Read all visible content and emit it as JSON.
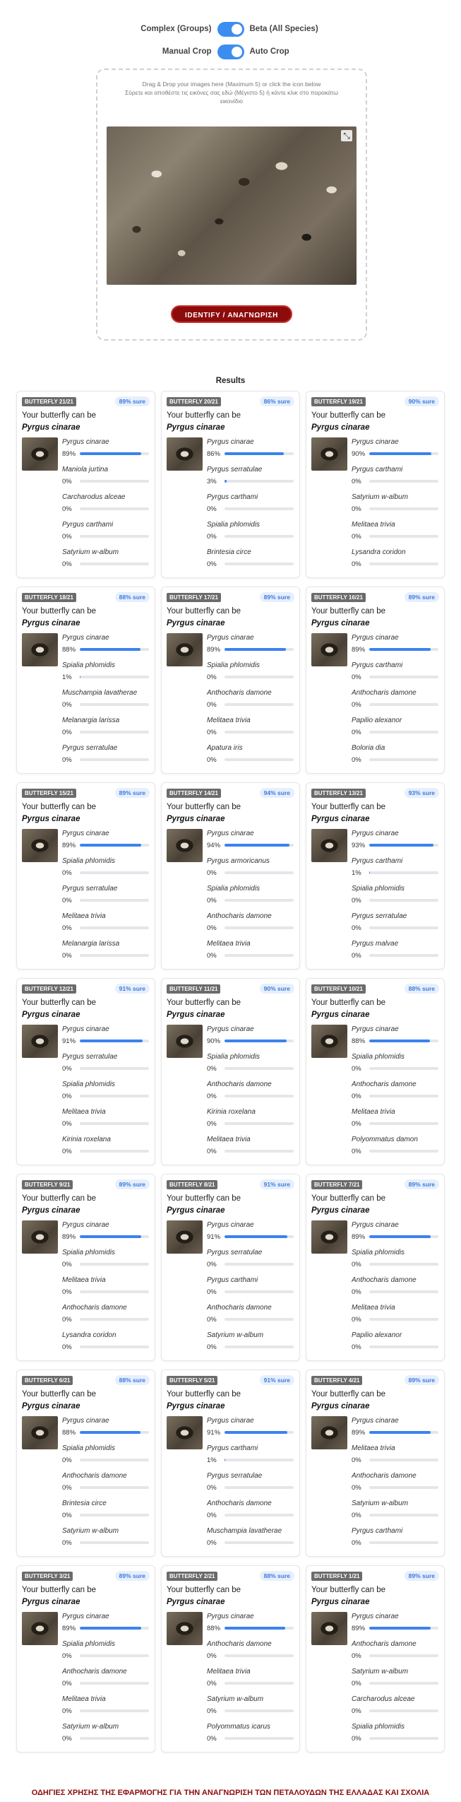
{
  "toggles": {
    "groups_label": "Complex (Groups)",
    "species_label": "Beta (All Species)",
    "manual_label": "Manual Crop",
    "auto_label": "Auto Crop"
  },
  "upload": {
    "instructions_en": "Drag & Drop your images here (Maximum 5) or click the icon below",
    "instructions_gr": "Σύρετε και αποθέστε τις εικόνες σας εδώ (Μέγιστο 5) ή κάντε κλικ στο παρακάτω εικονίδιο",
    "identify_label": "IDENTIFY / ΑΝΑΓΝΩΡΙΣΗ"
  },
  "results": {
    "title": "Results",
    "could_be": "Your butterfly can be",
    "cards": [
      {
        "badge": "BUTTERFLY 21/21",
        "sure": "89% sure",
        "top": "Pyrgus cinarae",
        "preds": [
          [
            "Pyrgus cinarae",
            "89%",
            0.89
          ],
          [
            "Maniola jurtina",
            "0%",
            0
          ],
          [
            "Carcharodus alceae",
            "0%",
            0
          ],
          [
            "Pyrgus carthami",
            "0%",
            0
          ],
          [
            "Satyrium w-album",
            "0%",
            0
          ]
        ]
      },
      {
        "badge": "BUTTERFLY 20/21",
        "sure": "86% sure",
        "top": "Pyrgus cinarae",
        "preds": [
          [
            "Pyrgus cinarae",
            "86%",
            0.86
          ],
          [
            "Pyrgus serratulae",
            "3%",
            0.03
          ],
          [
            "Pyrgus carthami",
            "0%",
            0
          ],
          [
            "Spialia phlomidis",
            "0%",
            0
          ],
          [
            "Brintesia circe",
            "0%",
            0
          ]
        ]
      },
      {
        "badge": "BUTTERFLY 19/21",
        "sure": "90% sure",
        "top": "Pyrgus cinarae",
        "preds": [
          [
            "Pyrgus cinarae",
            "90%",
            0.9
          ],
          [
            "Pyrgus carthami",
            "0%",
            0
          ],
          [
            "Satyrium w-album",
            "0%",
            0
          ],
          [
            "Melitaea trivia",
            "0%",
            0
          ],
          [
            "Lysandra coridon",
            "0%",
            0
          ]
        ]
      },
      {
        "badge": "BUTTERFLY 18/21",
        "sure": "88% sure",
        "top": "Pyrgus cinarae",
        "preds": [
          [
            "Pyrgus cinarae",
            "88%",
            0.88
          ],
          [
            "Spialia phlomidis",
            "1%",
            0.01
          ],
          [
            "Muschampia lavatherae",
            "0%",
            0
          ],
          [
            "Melanargia larissa",
            "0%",
            0
          ],
          [
            "Pyrgus serratulae",
            "0%",
            0
          ]
        ]
      },
      {
        "badge": "BUTTERFLY 17/21",
        "sure": "89% sure",
        "top": "Pyrgus cinarae",
        "preds": [
          [
            "Pyrgus cinarae",
            "89%",
            0.89
          ],
          [
            "Spialia phlomidis",
            "0%",
            0
          ],
          [
            "Anthocharis damone",
            "0%",
            0
          ],
          [
            "Melitaea trivia",
            "0%",
            0
          ],
          [
            "Apatura iris",
            "0%",
            0
          ]
        ]
      },
      {
        "badge": "BUTTERFLY 16/21",
        "sure": "89% sure",
        "top": "Pyrgus cinarae",
        "preds": [
          [
            "Pyrgus cinarae",
            "89%",
            0.89
          ],
          [
            "Pyrgus carthami",
            "0%",
            0
          ],
          [
            "Anthocharis damone",
            "0%",
            0
          ],
          [
            "Papilio alexanor",
            "0%",
            0
          ],
          [
            "Boloria dia",
            "0%",
            0
          ]
        ]
      },
      {
        "badge": "BUTTERFLY 15/21",
        "sure": "89% sure",
        "top": "Pyrgus cinarae",
        "preds": [
          [
            "Pyrgus cinarae",
            "89%",
            0.89
          ],
          [
            "Spialia phlomidis",
            "0%",
            0
          ],
          [
            "Pyrgus serratulae",
            "0%",
            0
          ],
          [
            "Melitaea trivia",
            "0%",
            0
          ],
          [
            "Melanargia larissa",
            "0%",
            0
          ]
        ]
      },
      {
        "badge": "BUTTERFLY 14/21",
        "sure": "94% sure",
        "top": "Pyrgus cinarae",
        "preds": [
          [
            "Pyrgus cinarae",
            "94%",
            0.94
          ],
          [
            "Pyrgus armoricanus",
            "0%",
            0
          ],
          [
            "Spialia phlomidis",
            "0%",
            0
          ],
          [
            "Anthocharis damone",
            "0%",
            0
          ],
          [
            "Melitaea trivia",
            "0%",
            0
          ]
        ]
      },
      {
        "badge": "BUTTERFLY 13/21",
        "sure": "93% sure",
        "top": "Pyrgus cinarae",
        "preds": [
          [
            "Pyrgus cinarae",
            "93%",
            0.93
          ],
          [
            "Pyrgus carthami",
            "1%",
            0.01
          ],
          [
            "Spialia phlomidis",
            "0%",
            0
          ],
          [
            "Pyrgus serratulae",
            "0%",
            0
          ],
          [
            "Pyrgus malvae",
            "0%",
            0
          ]
        ]
      },
      {
        "badge": "BUTTERFLY 12/21",
        "sure": "91% sure",
        "top": "Pyrgus cinarae",
        "preds": [
          [
            "Pyrgus cinarae",
            "91%",
            0.91
          ],
          [
            "Pyrgus serratulae",
            "0%",
            0
          ],
          [
            "Spialia phlomidis",
            "0%",
            0
          ],
          [
            "Melitaea trivia",
            "0%",
            0
          ],
          [
            "Kirinia roxelana",
            "0%",
            0
          ]
        ]
      },
      {
        "badge": "BUTTERFLY 11/21",
        "sure": "90% sure",
        "top": "Pyrgus cinarae",
        "preds": [
          [
            "Pyrgus cinarae",
            "90%",
            0.9
          ],
          [
            "Spialia phlomidis",
            "0%",
            0
          ],
          [
            "Anthocharis damone",
            "0%",
            0
          ],
          [
            "Kirinia roxelana",
            "0%",
            0
          ],
          [
            "Melitaea trivia",
            "0%",
            0
          ]
        ]
      },
      {
        "badge": "BUTTERFLY 10/21",
        "sure": "88% sure",
        "top": "Pyrgus cinarae",
        "preds": [
          [
            "Pyrgus cinarae",
            "88%",
            0.88
          ],
          [
            "Spialia phlomidis",
            "0%",
            0
          ],
          [
            "Anthocharis damone",
            "0%",
            0
          ],
          [
            "Melitaea trivia",
            "0%",
            0
          ],
          [
            "Polyommatus damon",
            "0%",
            0
          ]
        ]
      },
      {
        "badge": "BUTTERFLY 9/21",
        "sure": "89% sure",
        "top": "Pyrgus cinarae",
        "preds": [
          [
            "Pyrgus cinarae",
            "89%",
            0.89
          ],
          [
            "Spialia phlomidis",
            "0%",
            0
          ],
          [
            "Melitaea trivia",
            "0%",
            0
          ],
          [
            "Anthocharis damone",
            "0%",
            0
          ],
          [
            "Lysandra coridon",
            "0%",
            0
          ]
        ]
      },
      {
        "badge": "BUTTERFLY 8/21",
        "sure": "91% sure",
        "top": "Pyrgus cinarae",
        "preds": [
          [
            "Pyrgus cinarae",
            "91%",
            0.91
          ],
          [
            "Pyrgus serratulae",
            "0%",
            0
          ],
          [
            "Pyrgus carthami",
            "0%",
            0
          ],
          [
            "Anthocharis damone",
            "0%",
            0
          ],
          [
            "Satyrium w-album",
            "0%",
            0
          ]
        ]
      },
      {
        "badge": "BUTTERFLY 7/21",
        "sure": "89% sure",
        "top": "Pyrgus cinarae",
        "preds": [
          [
            "Pyrgus cinarae",
            "89%",
            0.89
          ],
          [
            "Spialia phlomidis",
            "0%",
            0
          ],
          [
            "Anthocharis damone",
            "0%",
            0
          ],
          [
            "Melitaea trivia",
            "0%",
            0
          ],
          [
            "Papilio alexanor",
            "0%",
            0
          ]
        ]
      },
      {
        "badge": "BUTTERFLY 6/21",
        "sure": "88% sure",
        "top": "Pyrgus cinarae",
        "preds": [
          [
            "Pyrgus cinarae",
            "88%",
            0.88
          ],
          [
            "Spialia phlomidis",
            "0%",
            0
          ],
          [
            "Anthocharis damone",
            "0%",
            0
          ],
          [
            "Brintesia circe",
            "0%",
            0
          ],
          [
            "Satyrium w-album",
            "0%",
            0
          ]
        ]
      },
      {
        "badge": "BUTTERFLY 5/21",
        "sure": "91% sure",
        "top": "Pyrgus cinarae",
        "preds": [
          [
            "Pyrgus cinarae",
            "91%",
            0.91
          ],
          [
            "Pyrgus carthami",
            "1%",
            0.01
          ],
          [
            "Pyrgus serratulae",
            "0%",
            0
          ],
          [
            "Anthocharis damone",
            "0%",
            0
          ],
          [
            "Muschampia lavatherae",
            "0%",
            0
          ]
        ]
      },
      {
        "badge": "BUTTERFLY 4/21",
        "sure": "89% sure",
        "top": "Pyrgus cinarae",
        "preds": [
          [
            "Pyrgus cinarae",
            "89%",
            0.89
          ],
          [
            "Melitaea trivia",
            "0%",
            0
          ],
          [
            "Anthocharis damone",
            "0%",
            0
          ],
          [
            "Satyrium w-album",
            "0%",
            0
          ],
          [
            "Pyrgus carthami",
            "0%",
            0
          ]
        ]
      },
      {
        "badge": "BUTTERFLY 3/21",
        "sure": "89% sure",
        "top": "Pyrgus cinarae",
        "preds": [
          [
            "Pyrgus cinarae",
            "89%",
            0.89
          ],
          [
            "Spialia phlomidis",
            "0%",
            0
          ],
          [
            "Anthocharis damone",
            "0%",
            0
          ],
          [
            "Melitaea trivia",
            "0%",
            0
          ],
          [
            "Satyrium w-album",
            "0%",
            0
          ]
        ]
      },
      {
        "badge": "BUTTERFLY 2/21",
        "sure": "88% sure",
        "top": "Pyrgus cinarae",
        "preds": [
          [
            "Pyrgus cinarae",
            "88%",
            0.88
          ],
          [
            "Anthocharis damone",
            "0%",
            0
          ],
          [
            "Melitaea trivia",
            "0%",
            0
          ],
          [
            "Satyrium w-album",
            "0%",
            0
          ],
          [
            "Polyommatus icarus",
            "0%",
            0
          ]
        ]
      },
      {
        "badge": "BUTTERFLY 1/21",
        "sure": "89% sure",
        "top": "Pyrgus cinarae",
        "preds": [
          [
            "Pyrgus cinarae",
            "89%",
            0.89
          ],
          [
            "Anthocharis damone",
            "0%",
            0
          ],
          [
            "Satyrium w-album",
            "0%",
            0
          ],
          [
            "Carcharodus alceae",
            "0%",
            0
          ],
          [
            "Spialia phlomidis",
            "0%",
            0
          ]
        ]
      }
    ]
  },
  "footer": {
    "guide_text": "ΟΔΗΓΙΕΣ ΧΡΗΣΗΣ ΤΗΣ ΕΦΑΡΜΟΓΗΣ ΓΙΑ ΤΗΝ ΑΝΑΓΝΩΡΙΣΗ ΤΩΝ ΠΕΤΑΛΟΥΔΩΝ ΤΗΣ ΕΛΛΑΔΑΣ ΚΑΙ ΣΧΟΛΙΑ"
  },
  "colors": {
    "accent": "#3b82f0",
    "identify_button": "#8c0b0b",
    "badge": "#6b6b6b"
  },
  "icons": {
    "crop": "crop-icon"
  }
}
